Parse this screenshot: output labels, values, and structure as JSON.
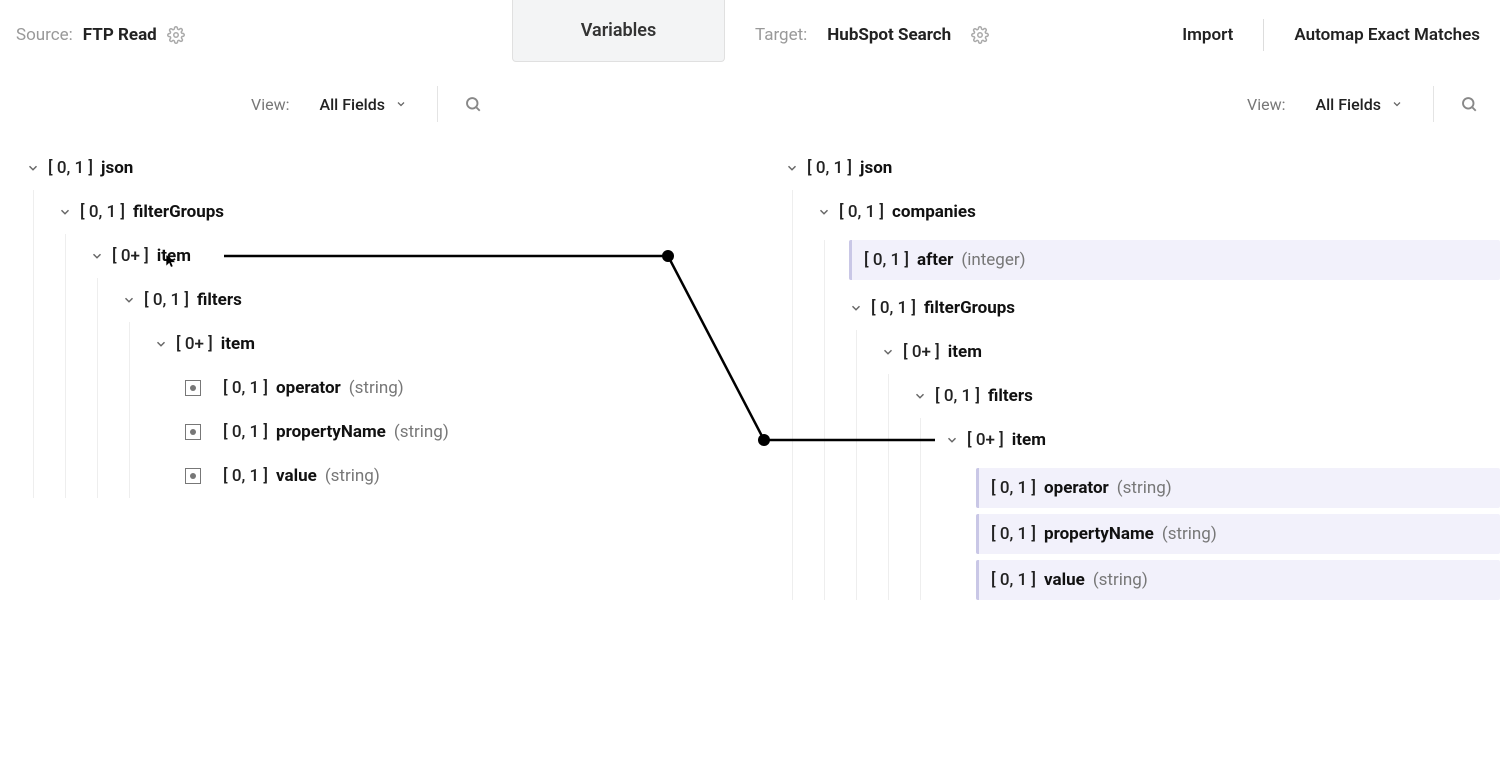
{
  "source": {
    "label": "Source:",
    "name": "FTP Read"
  },
  "center": {
    "tab": "Variables"
  },
  "target": {
    "label": "Target:",
    "name": "HubSpot Search"
  },
  "actions": {
    "import": "Import",
    "automap": "Automap Exact Matches"
  },
  "toolbar": {
    "viewLabel": "View:",
    "viewValue": "All Fields"
  },
  "cards": {
    "p01": "[ 0, 1 ]",
    "p0p": "[ 0+ ]"
  },
  "srcTree": {
    "json": "json",
    "filterGroups": "filterGroups",
    "item": "item",
    "filters": "filters",
    "operator": "operator",
    "propertyName": "propertyName",
    "value": "value",
    "tString": "(string)"
  },
  "tgtTree": {
    "json": "json",
    "companies": "companies",
    "after": "after",
    "tInteger": "(integer)",
    "filterGroups": "filterGroups",
    "item": "item",
    "filters": "filters",
    "operator": "operator",
    "propertyName": "propertyName",
    "value": "value",
    "tString": "(string)"
  }
}
